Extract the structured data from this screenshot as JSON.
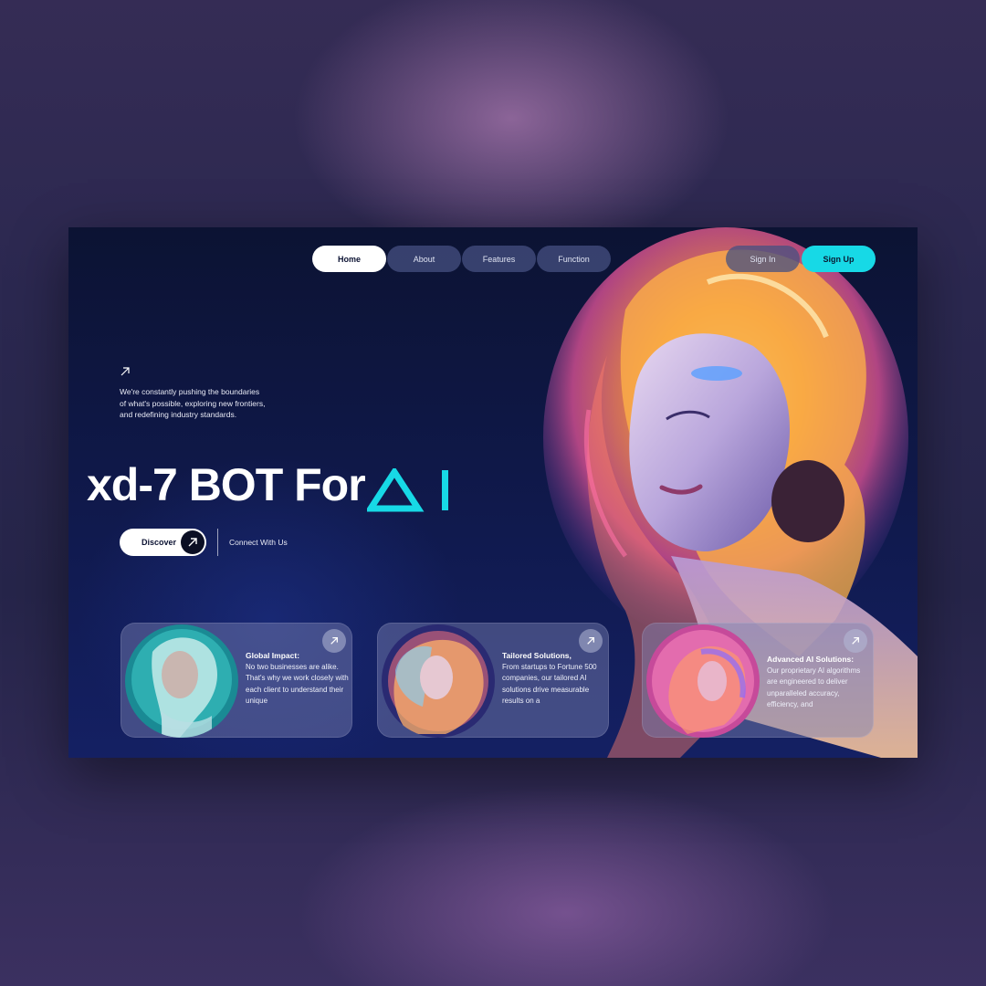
{
  "nav": {
    "items": [
      {
        "label": "Home"
      },
      {
        "label": "About"
      },
      {
        "label": "Features"
      },
      {
        "label": "Function"
      }
    ],
    "sign_in": "Sign In",
    "sign_up": "Sign Up"
  },
  "intro": {
    "text": "We're constantly pushing the boundaries of what's possible, exploring new frontiers, and redefining industry standards."
  },
  "hero": {
    "title": "xd-7 BOT For",
    "accent_text": "AI",
    "accent_color": "#17d9e6"
  },
  "cta": {
    "discover_label": "Discover",
    "connect_label": "Connect With Us"
  },
  "cards": [
    {
      "title": "Global Impact:",
      "body": "No two businesses are alike. That's why we work closely with each client to understand their unique"
    },
    {
      "title": "Tailored Solutions,",
      "body": "From startups to Fortune 500 companies, our tailored AI solutions drive measurable results on a"
    },
    {
      "title": "Advanced AI Solutions:",
      "body": "Our proprietary AI algorithms are engineered to deliver unparalleled accuracy, efficiency, and"
    }
  ],
  "icons": {
    "intro": "arrow-up-right-icon",
    "discover": "arrow-up-right-icon",
    "card": "arrow-up-right-icon"
  },
  "colors": {
    "accent": "#17d9e6",
    "background": "#0f1848"
  }
}
